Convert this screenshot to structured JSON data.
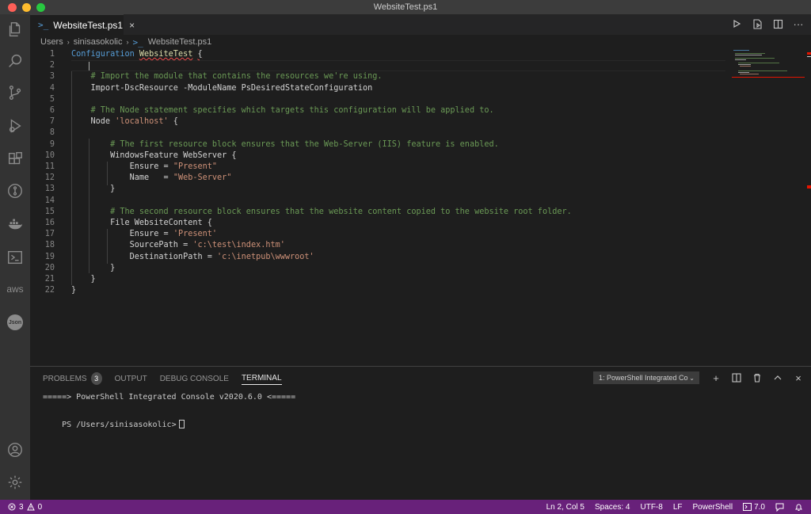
{
  "window": {
    "title": "WebsiteTest.ps1"
  },
  "tab": {
    "label": "WebsiteTest.ps1",
    "close_glyph": "×"
  },
  "breadcrumb": {
    "items": [
      "Users",
      "sinisasokolic",
      "WebsiteTest.ps1"
    ]
  },
  "activity_bar": {
    "icons": [
      "files-icon",
      "search-icon",
      "source-control-icon",
      "run-debug-icon",
      "extensions-icon",
      "git-graph-icon",
      "docker-icon",
      "powershell-icon",
      "aws-icon",
      "json-icon",
      "account-icon",
      "settings-gear-icon"
    ],
    "aws_label": "aws",
    "json_label": "Json"
  },
  "editor": {
    "line_numbers": [
      "1",
      "2",
      "3",
      "4",
      "5",
      "6",
      "7",
      "8",
      "9",
      "10",
      "11",
      "12",
      "13",
      "14",
      "15",
      "16",
      "17",
      "18",
      "19",
      "20",
      "21",
      "22"
    ],
    "lines": [
      [
        {
          "t": "Configuration ",
          "c": "kw"
        },
        {
          "t": "WebsiteTest",
          "c": "fn squig"
        },
        {
          "t": " ",
          "c": ""
        },
        {
          "t": "{",
          "c": "squig"
        }
      ],
      [],
      [
        {
          "t": "    # Import the module that contains the resources we're using.",
          "c": "cm"
        }
      ],
      [
        {
          "t": "    Import-DscResource -ModuleName PsDesiredStateConfiguration",
          "c": ""
        }
      ],
      [],
      [
        {
          "t": "    # The Node statement specifies which targets this configuration will be applied to.",
          "c": "cm"
        }
      ],
      [
        {
          "t": "    Node ",
          "c": ""
        },
        {
          "t": "'localhost'",
          "c": "str"
        },
        {
          "t": " {",
          "c": ""
        }
      ],
      [],
      [
        {
          "t": "        # The first resource block ensures that the Web-Server (IIS) feature is enabled.",
          "c": "cm"
        }
      ],
      [
        {
          "t": "        WindowsFeature WebServer {",
          "c": ""
        }
      ],
      [
        {
          "t": "            Ensure = ",
          "c": ""
        },
        {
          "t": "\"Present\"",
          "c": "str"
        }
      ],
      [
        {
          "t": "            Name   = ",
          "c": ""
        },
        {
          "t": "\"Web-Server\"",
          "c": "str"
        }
      ],
      [
        {
          "t": "        }",
          "c": ""
        }
      ],
      [],
      [
        {
          "t": "        # The second resource block ensures that the website content copied to the website root folder.",
          "c": "cm"
        }
      ],
      [
        {
          "t": "        File WebsiteContent {",
          "c": ""
        }
      ],
      [
        {
          "t": "            Ensure = ",
          "c": ""
        },
        {
          "t": "'Present'",
          "c": "str"
        }
      ],
      [
        {
          "t": "            SourcePath = ",
          "c": ""
        },
        {
          "t": "'c:\\test\\index.htm'",
          "c": "str"
        }
      ],
      [
        {
          "t": "            DestinationPath = ",
          "c": ""
        },
        {
          "t": "'c:\\inetpub\\wwwroot'",
          "c": "str"
        }
      ],
      [
        {
          "t": "        }",
          "c": ""
        }
      ],
      [
        {
          "t": "    }",
          "c": ""
        }
      ],
      [
        {
          "t": "}",
          "c": ""
        }
      ]
    ]
  },
  "panel": {
    "tabs": [
      {
        "label": "PROBLEMS",
        "badge": "3"
      },
      {
        "label": "OUTPUT"
      },
      {
        "label": "DEBUG CONSOLE"
      },
      {
        "label": "TERMINAL",
        "active": true
      }
    ],
    "terminal_select": "1: PowerShell Integrated Co",
    "terminal_lines": [
      "=====> PowerShell Integrated Console v2020.6.0 <=====",
      "PS /Users/sinisasokolic>"
    ]
  },
  "status_bar": {
    "errors": "3",
    "warnings": "0",
    "position": "Ln 2, Col 5",
    "spaces": "Spaces: 4",
    "encoding": "UTF-8",
    "eol": "LF",
    "language": "PowerShell",
    "ps_version": "7.0"
  },
  "colors": {
    "status_bar": "#68217a",
    "keyword": "#569cd6",
    "comment": "#6a9955",
    "string": "#ce9178"
  }
}
